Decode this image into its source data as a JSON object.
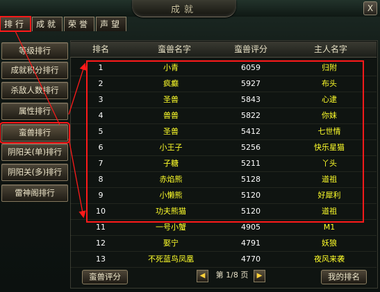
{
  "window": {
    "title": "成就",
    "close_label": "X"
  },
  "top_tabs": [
    {
      "label": "排行",
      "active": true
    },
    {
      "label": "成就",
      "active": false
    },
    {
      "label": "荣誉",
      "active": false
    },
    {
      "label": "声望",
      "active": false
    }
  ],
  "sidebar": {
    "items": [
      {
        "label": "等级排行"
      },
      {
        "label": "成就积分排行"
      },
      {
        "label": "杀敌人数排行"
      },
      {
        "label": "属性排行"
      },
      {
        "label": "蛮兽排行"
      },
      {
        "label": "阴阳关(单)排行"
      },
      {
        "label": "阴阳关(多)排行"
      },
      {
        "label": "雷神阁排行"
      }
    ],
    "active_index": 4
  },
  "table": {
    "headers": [
      "排名",
      "蛮兽名字",
      "蛮兽评分",
      "主人名字"
    ],
    "rows": [
      {
        "rank": "1",
        "name": "小青",
        "score": "6059",
        "owner": "归附"
      },
      {
        "rank": "2",
        "name": "疯癫",
        "score": "5927",
        "owner": "布头"
      },
      {
        "rank": "3",
        "name": "圣兽",
        "score": "5843",
        "owner": "心逮"
      },
      {
        "rank": "4",
        "name": "兽兽",
        "score": "5822",
        "owner": "你妹"
      },
      {
        "rank": "5",
        "name": "圣兽",
        "score": "5412",
        "owner": "七世情"
      },
      {
        "rank": "6",
        "name": "小王子",
        "score": "5256",
        "owner": "快乐星猫"
      },
      {
        "rank": "7",
        "name": "子糖",
        "score": "5211",
        "owner": "丫头"
      },
      {
        "rank": "8",
        "name": "赤焰熊",
        "score": "5128",
        "owner": "道祖"
      },
      {
        "rank": "9",
        "name": "小懒熊",
        "score": "5120",
        "owner": "好犀利"
      },
      {
        "rank": "10",
        "name": "功夫熊猫",
        "score": "5120",
        "owner": "道祖"
      },
      {
        "rank": "11",
        "name": "一号小蟹",
        "score": "4905",
        "owner": "M1"
      },
      {
        "rank": "12",
        "name": "娶宁",
        "score": "4791",
        "owner": "妖狼"
      },
      {
        "rank": "13",
        "name": "不死蓝鸟凤凰",
        "score": "4770",
        "owner": "夜风来袭"
      }
    ]
  },
  "footer": {
    "left_button": "蛮兽评分",
    "pager": {
      "prefix": "第",
      "current": "1",
      "total": "8",
      "suffix": "页",
      "text": "第 1/8 页"
    },
    "right_button": "我的排名"
  },
  "colors": {
    "accent": "#ff1a1a",
    "row_text": "#ffff2a",
    "rank_text": "#ffffff"
  }
}
